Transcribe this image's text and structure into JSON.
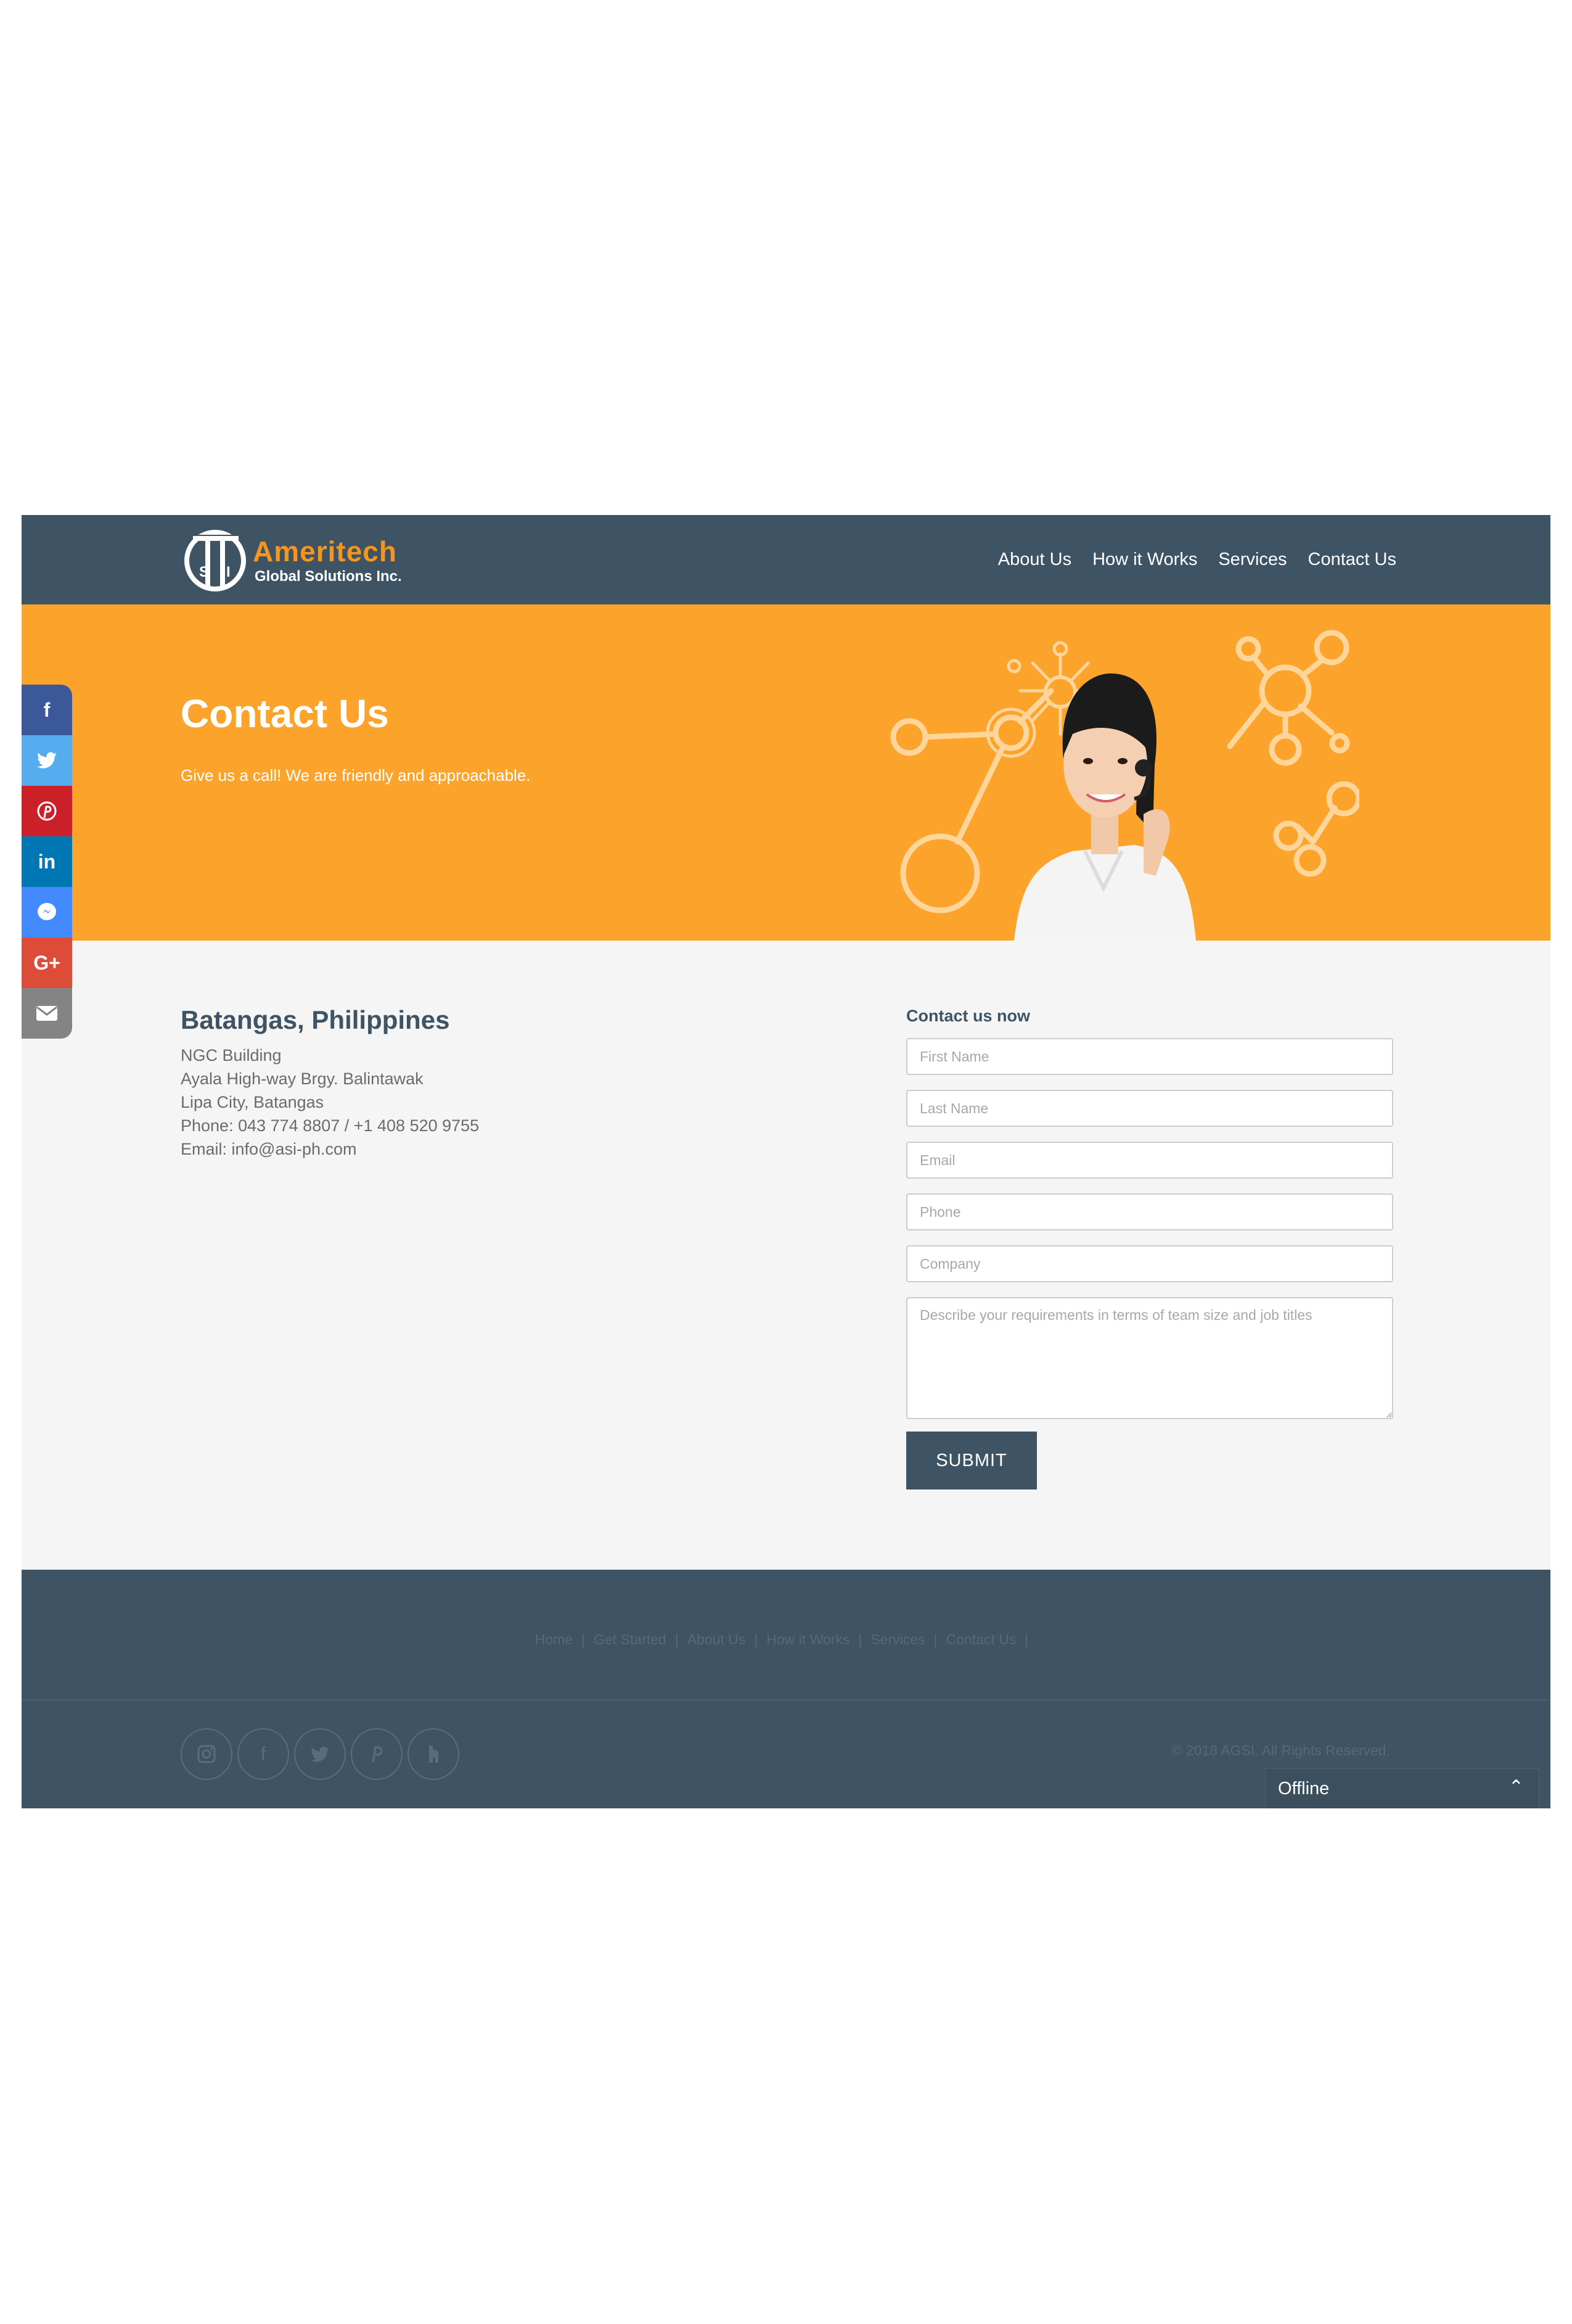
{
  "brand": {
    "name": "Ameritech",
    "tagline": "Global Solutions Inc.",
    "logo_text": "ASI",
    "color": "#f3951f"
  },
  "nav": [
    "About Us",
    "How it Works",
    "Services",
    "Contact Us"
  ],
  "hero": {
    "title": "Contact Us",
    "subtitle": "Give us a call! We are friendly and approachable.",
    "bg_color": "#fca32c"
  },
  "share_bar": [
    {
      "icon": "facebook-icon",
      "glyph": "f",
      "color": "#3b5998"
    },
    {
      "icon": "twitter-icon",
      "glyph": "🐦",
      "color": "#55acee"
    },
    {
      "icon": "pinterest-icon",
      "glyph": "P",
      "color": "#cb2027"
    },
    {
      "icon": "linkedin-icon",
      "glyph": "in",
      "color": "#0077b5"
    },
    {
      "icon": "messenger-icon",
      "glyph": "💬",
      "color": "#448aff"
    },
    {
      "icon": "google-plus-icon",
      "glyph": "G+",
      "color": "#dd4b39"
    },
    {
      "icon": "email-icon",
      "glyph": "✉",
      "color": "#848484"
    }
  ],
  "address": {
    "title": "Batangas, Philippines",
    "lines": [
      "NGC Building",
      "Ayala High-way Brgy. Balintawak",
      "Lipa City, Batangas",
      "Phone: 043 774 8807 / +1 408 520 9755",
      "Email: info@asi-ph.com"
    ]
  },
  "form": {
    "title": "Contact us now",
    "placeholders": {
      "first_name": "First Name",
      "last_name": "Last Name",
      "email": "Email",
      "phone": "Phone",
      "company": "Company",
      "requirements": "Describe your requirements in terms of team size and job titles"
    },
    "submit_label": "SUBMIT"
  },
  "footer": {
    "links": [
      "Home",
      "Get Started",
      "About Us",
      "How it Works",
      "Services",
      "Contact Us"
    ],
    "separator": "|",
    "socials": [
      "instagram-icon",
      "facebook-icon",
      "twitter-icon",
      "pinterest-icon",
      "houzz-icon"
    ],
    "copyright": "© 2018 AGSI. All Rights Reserved."
  },
  "chat": {
    "status": "Offline",
    "caret": "⌃"
  },
  "colors": {
    "header": "#3e5363",
    "page_bg": "#f5f5f5",
    "accent": "#fca32c"
  }
}
